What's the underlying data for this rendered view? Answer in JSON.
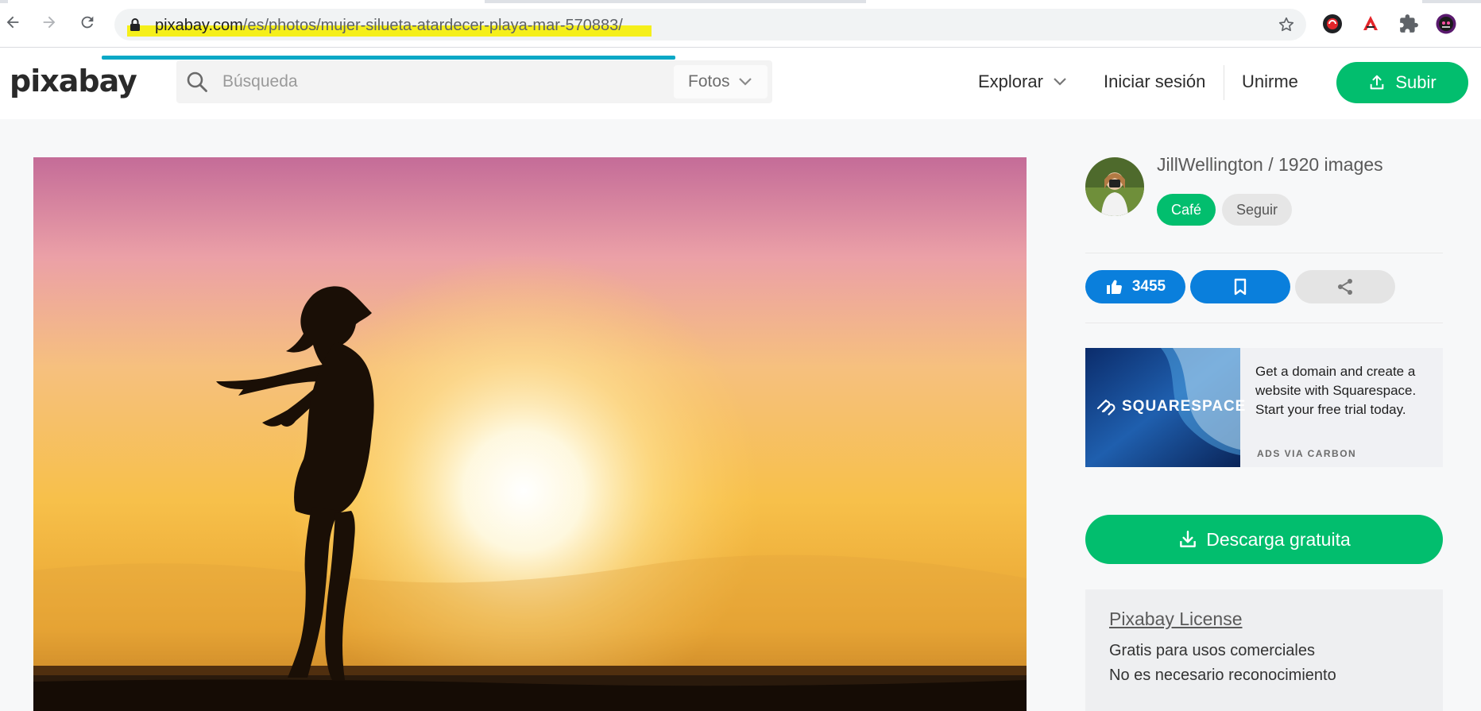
{
  "browser": {
    "url_host": "pixabay.com",
    "url_path": "/es/photos/mujer-silueta-atardecer-playa-mar-570883/",
    "highlight_color": "#f5ef1a",
    "icons": [
      "back-icon",
      "forward-icon",
      "reload-icon",
      "lock-icon",
      "star-icon",
      "extension-icon",
      "puzzle-icon",
      "profile-avatar"
    ]
  },
  "header": {
    "logo": "pixabay",
    "search_placeholder": "Búsqueda",
    "search_type": "Fotos",
    "nav": {
      "explore": "Explorar",
      "login": "Iniciar sesión",
      "join": "Unirme"
    },
    "upload_label": "Subir",
    "accent_color": "#02be6e"
  },
  "photo": {
    "subject": "woman silhouette at sunset on the beach"
  },
  "sidebar": {
    "author_name": "JillWellington",
    "author_sep": " / ",
    "author_images": "1920 images",
    "coffee_label": "Café",
    "follow_label": "Seguir",
    "likes": "3455",
    "like_color": "#0a7fdc",
    "ad": {
      "brand": "SQUARESPACE",
      "text": "Get a domain and create a website with Squarespace. Start your free trial today.",
      "via": "ADS VIA CARBON"
    },
    "download_label": "Descarga gratuita",
    "license": {
      "title": "Pixabay License",
      "line1": "Gratis para usos comerciales",
      "line2": "No es necesario reconocimiento"
    }
  }
}
